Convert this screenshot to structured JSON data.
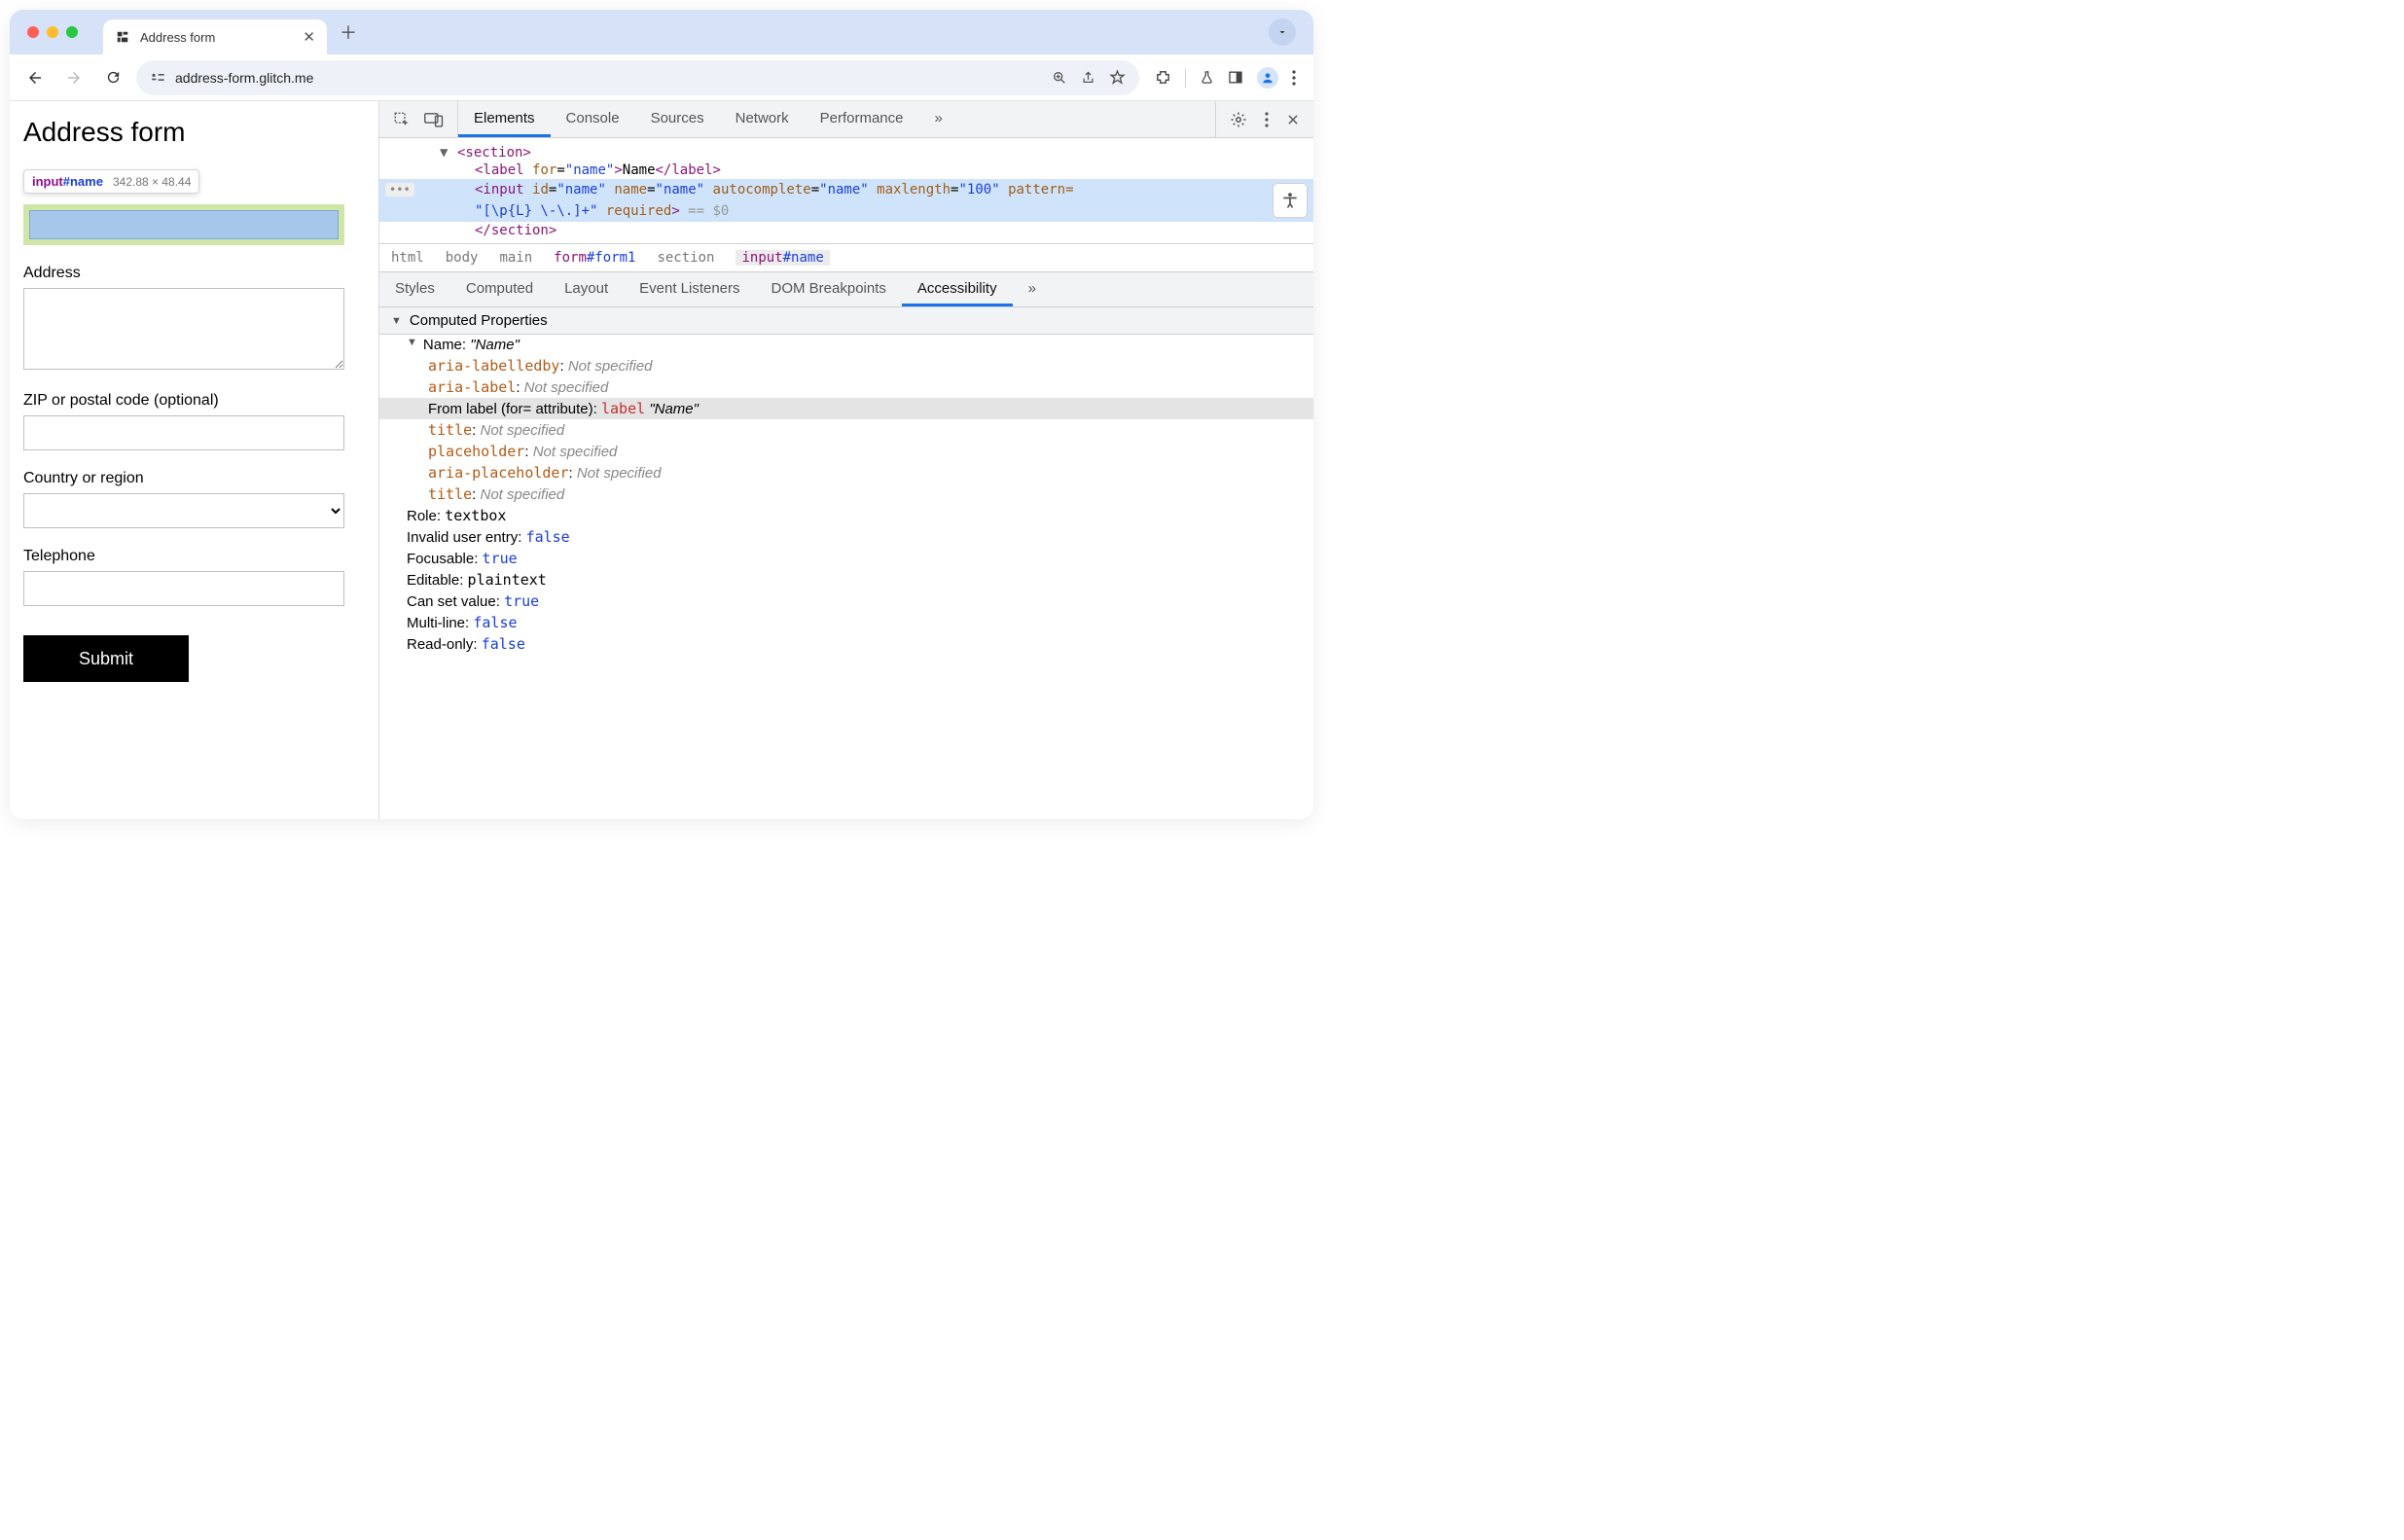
{
  "browser": {
    "tab_title": "Address form",
    "url": "address-form.glitch.me"
  },
  "page": {
    "title": "Address form",
    "inspect_tooltip": {
      "tag": "input",
      "id": "#name",
      "dimensions": "342.88 × 48.44"
    },
    "labels": {
      "address": "Address",
      "zip": "ZIP or postal code (optional)",
      "country": "Country or region",
      "telephone": "Telephone"
    },
    "submit": "Submit"
  },
  "devtools": {
    "tabs": [
      "Elements",
      "Console",
      "Sources",
      "Network",
      "Performance"
    ],
    "active_tab": "Elements",
    "dom": {
      "section_open": "<section>",
      "label_line": {
        "for": "name",
        "text": "Name"
      },
      "input_line": {
        "id": "name",
        "name": "name",
        "autocomplete": "name",
        "maxlength": "100",
        "pattern_head": "pattern=",
        "pattern_value": "\"[\\p{L} \\-\\.]+\"",
        "required": "required",
        "trailer": " == $0"
      },
      "section_close": "</section>"
    },
    "breadcrumb": [
      "html",
      "body",
      "main",
      "form#form1",
      "section",
      "input#name"
    ],
    "sub_tabs": [
      "Styles",
      "Computed",
      "Layout",
      "Event Listeners",
      "DOM Breakpoints",
      "Accessibility"
    ],
    "active_sub_tab": "Accessibility",
    "computed_properties_header": "Computed Properties",
    "a11y": {
      "name_label": "Name:",
      "name_value": "\"Name\"",
      "rows": [
        {
          "key": "aria-labelledby",
          "value": "Not specified",
          "ns": true
        },
        {
          "key": "aria-label",
          "value": "Not specified",
          "ns": true
        }
      ],
      "from_label_text": "From label (for= attribute):",
      "from_label_tag": "label",
      "from_label_value": "\"Name\"",
      "rows2": [
        {
          "key": "title",
          "value": "Not specified",
          "ns": true
        },
        {
          "key": "placeholder",
          "value": "Not specified",
          "ns": true
        },
        {
          "key": "aria-placeholder",
          "value": "Not specified",
          "ns": true
        },
        {
          "key": "title",
          "value": "Not specified",
          "ns": true
        }
      ],
      "plain": [
        {
          "label": "Role:",
          "value": "textbox",
          "kw": false,
          "mono": true
        },
        {
          "label": "Invalid user entry:",
          "value": "false",
          "kw": true
        },
        {
          "label": "Focusable:",
          "value": "true",
          "kw": true
        },
        {
          "label": "Editable:",
          "value": "plaintext",
          "kw": false,
          "mono": true
        },
        {
          "label": "Can set value:",
          "value": "true",
          "kw": true
        },
        {
          "label": "Multi-line:",
          "value": "false",
          "kw": true
        },
        {
          "label": "Read-only:",
          "value": "false",
          "kw": true
        }
      ]
    }
  }
}
